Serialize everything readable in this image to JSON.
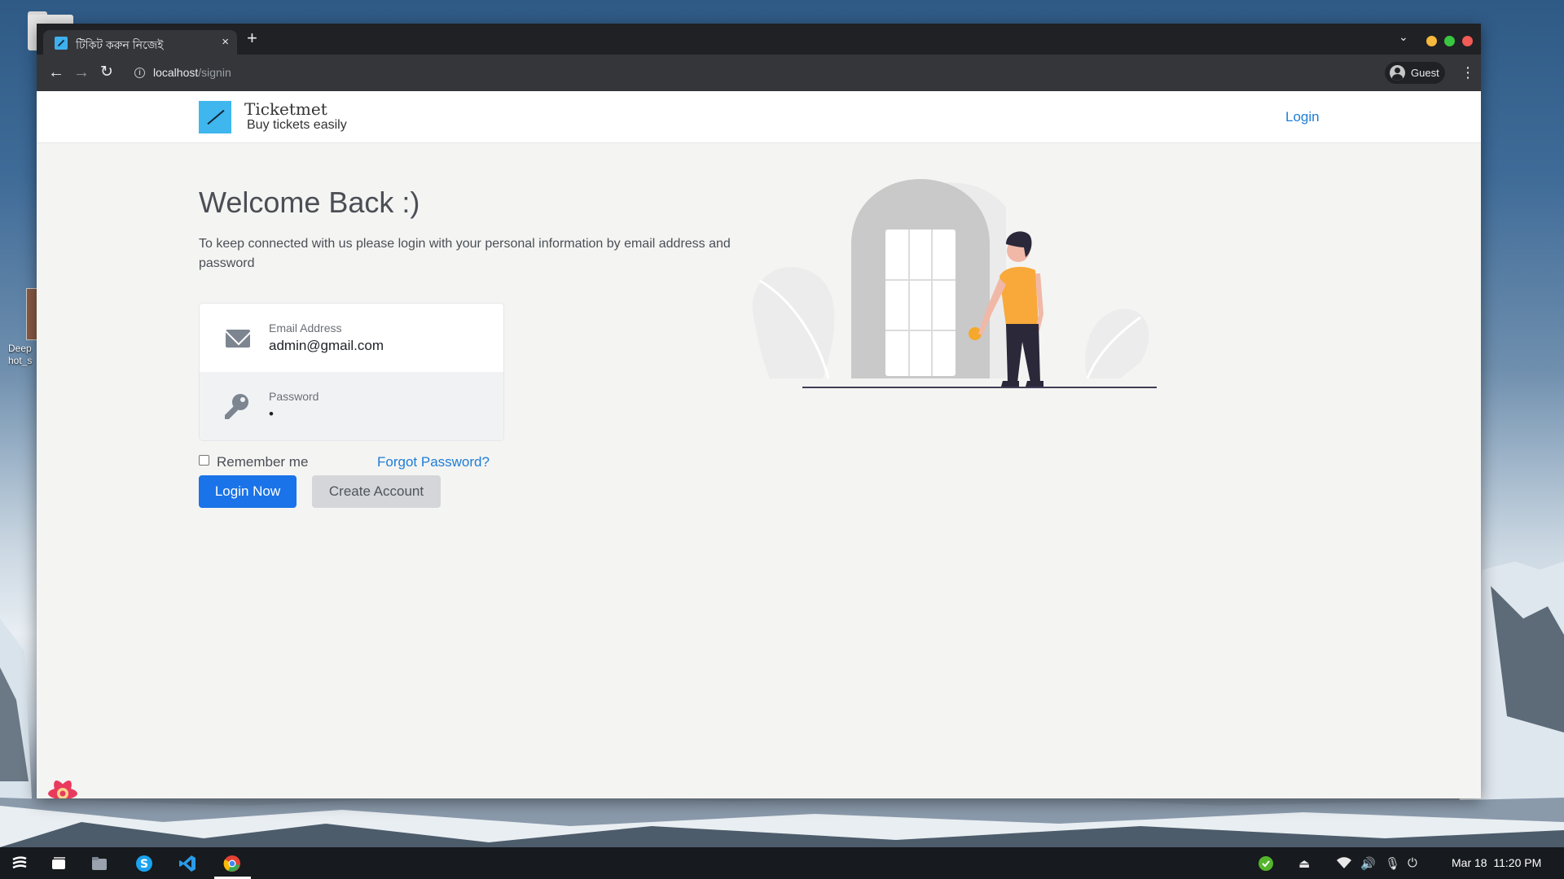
{
  "desktop": {
    "icon_label": "Deep hot_s"
  },
  "browser": {
    "tab_title": "টিকিট করুন নিজেই",
    "tab_close": "×",
    "new_tab": "+",
    "url_host": "localhost",
    "url_path": "/signin",
    "profile_label": "Guest"
  },
  "site": {
    "brand_name": "Ticketmet",
    "brand_tagline": "Buy tickets easily",
    "nav_login": "Login",
    "accent_color": "#1a73e8",
    "logo_color": "#3fb6ee"
  },
  "signin": {
    "title": "Welcome Back :)",
    "subtitle": "To keep connected with us please login with your personal information by email address and password",
    "email_label": "Email Address",
    "email_value": "admin@gmail.com",
    "password_label": "Password",
    "password_value": "•",
    "remember_label": "Remember me",
    "remember_checked": false,
    "forgot_label": "Forgot Password?",
    "login_button": "Login Now",
    "create_button": "Create Account"
  },
  "taskbar": {
    "apps": [
      "launcher-icon",
      "multitasking-icon",
      "file-manager-icon",
      "skype-icon",
      "vscode-icon",
      "chrome-icon"
    ],
    "tray": [
      "shield-icon",
      "eject-icon",
      "wifi-icon",
      "volume-icon",
      "mic-icon",
      "power-icon"
    ],
    "date": "Mar 18",
    "time": "11:20 PM"
  }
}
